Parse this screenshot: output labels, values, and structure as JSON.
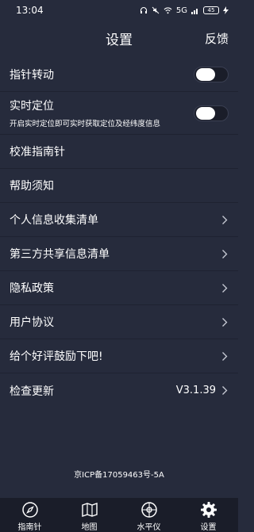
{
  "status_bar": {
    "time": "13:04",
    "network": "5G",
    "battery": "45"
  },
  "header": {
    "title": "设置",
    "action": "反馈"
  },
  "settings": {
    "pointer_rotation": {
      "label": "指针转动",
      "enabled": false
    },
    "realtime_location": {
      "label": "实时定位",
      "subtitle": "开启实时定位即可实时获取定位及经纬度信息",
      "enabled": false
    },
    "calibrate": {
      "label": "校准指南针"
    },
    "help": {
      "label": "帮助须知"
    },
    "personal_info": {
      "label": "个人信息收集清单"
    },
    "third_party": {
      "label": "第三方共享信息清单"
    },
    "privacy": {
      "label": "隐私政策"
    },
    "user_agreement": {
      "label": "用户协议"
    },
    "rate_us": {
      "label": "给个好评鼓励下吧!"
    },
    "check_update": {
      "label": "检查更新",
      "version": "V3.1.39"
    }
  },
  "footer": {
    "icp": "京ICP备17059463号-5A"
  },
  "bottom_nav": [
    {
      "label": "指南针",
      "icon": "compass-icon"
    },
    {
      "label": "地图",
      "icon": "map-icon"
    },
    {
      "label": "水平仪",
      "icon": "level-icon"
    },
    {
      "label": "设置",
      "icon": "gear-icon",
      "active": true
    }
  ]
}
